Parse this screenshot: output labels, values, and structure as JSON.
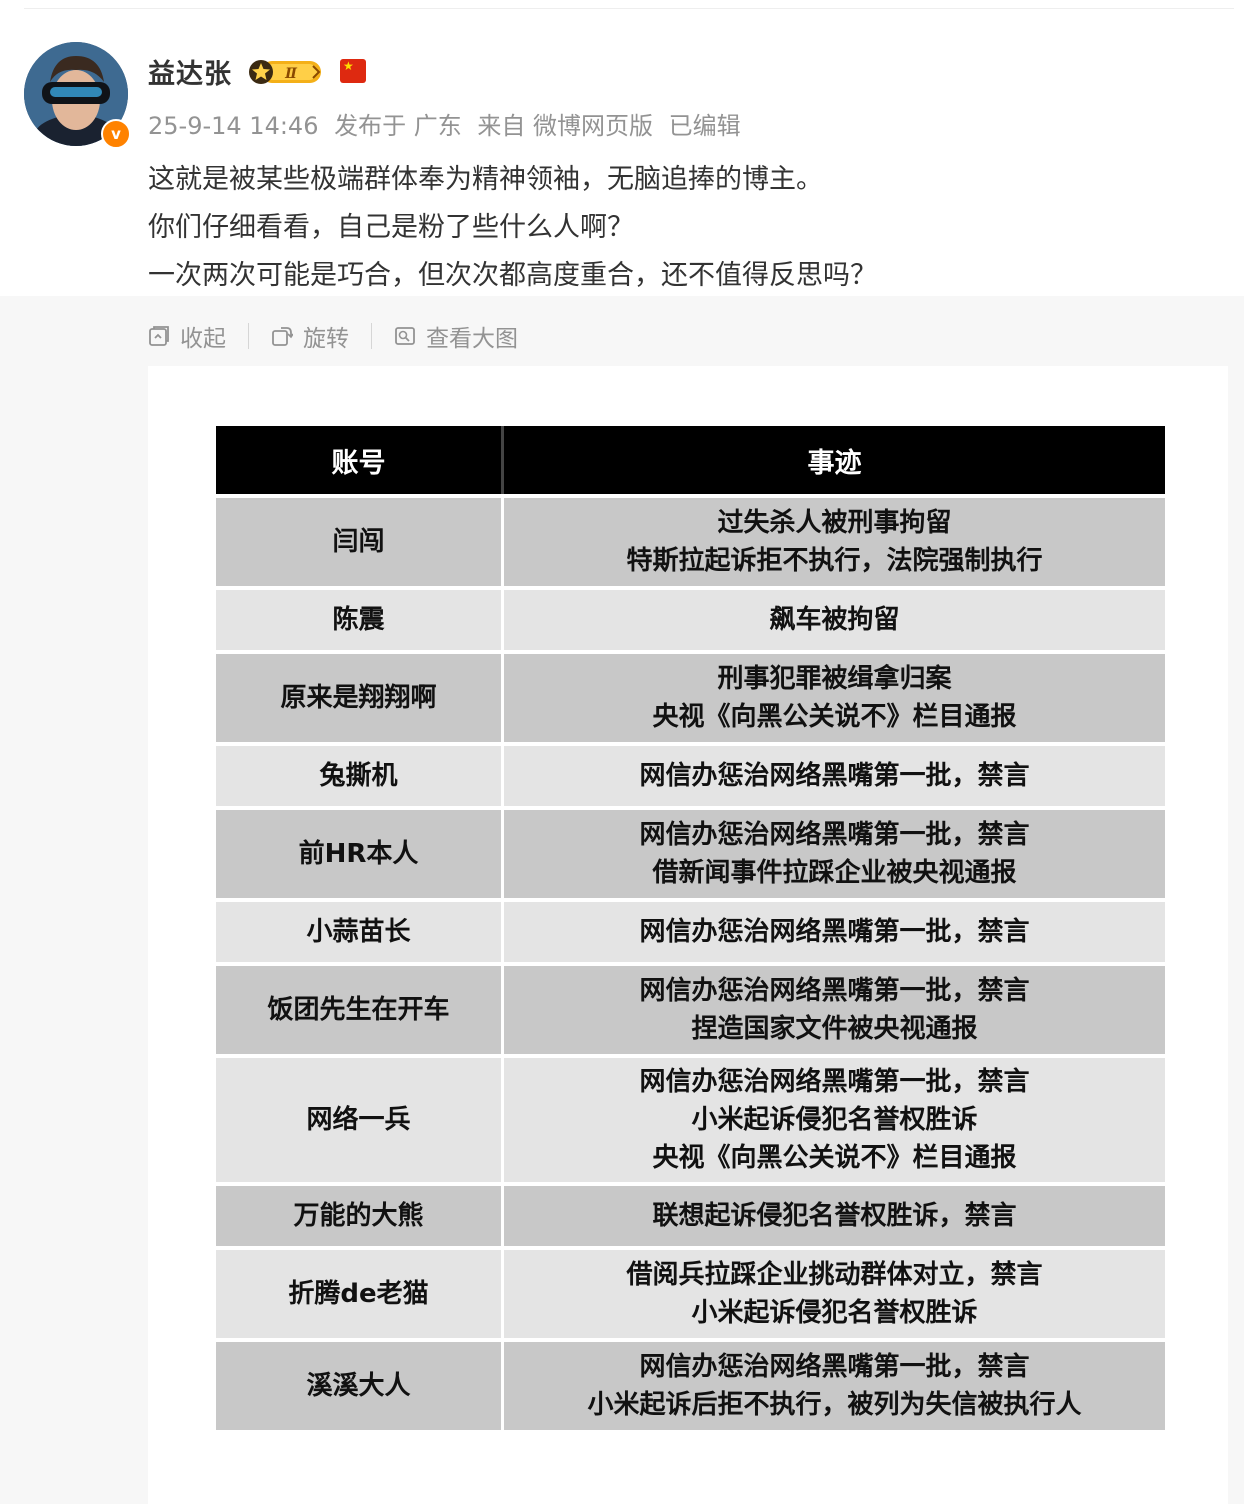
{
  "author": {
    "name": "益达张",
    "vip_level": "Ⅱ",
    "verified": true,
    "flag": "flag-icon"
  },
  "meta": {
    "date": "25-9-14 14:46",
    "location": "发布于 广东",
    "source": "来自 微博网页版",
    "edited": "已编辑"
  },
  "post": {
    "lines": [
      "这就是被某些极端群体奉为精神领袖，无脑追捧的博主。",
      "你们仔细看看，自己是粉了些什么人啊？",
      "一次两次可能是巧合，但次次都高度重合，还不值得反思吗？"
    ]
  },
  "toolbar": {
    "collapse": "收起",
    "rotate": "旋转",
    "view_large": "查看大图"
  },
  "table": {
    "headers": [
      "账号",
      "事迹"
    ],
    "rows": [
      {
        "account": "闫闯",
        "deeds": [
          "过失杀人被刑事拘留",
          "特斯拉起诉拒不执行，法院强制执行"
        ],
        "shade": "dark"
      },
      {
        "account": "陈震",
        "deeds": [
          "飙车被拘留"
        ],
        "shade": "light"
      },
      {
        "account": "原来是翔翔啊",
        "deeds": [
          "刑事犯罪被缉拿归案",
          "央视《向黑公关说不》栏目通报"
        ],
        "shade": "dark"
      },
      {
        "account": "兔撕机",
        "deeds": [
          "网信办惩治网络黑嘴第一批，禁言"
        ],
        "shade": "light"
      },
      {
        "account": "前HR本人",
        "deeds": [
          "网信办惩治网络黑嘴第一批，禁言",
          "借新闻事件拉踩企业被央视通报"
        ],
        "shade": "dark"
      },
      {
        "account": "小蒜苗长",
        "deeds": [
          "网信办惩治网络黑嘴第一批，禁言"
        ],
        "shade": "light"
      },
      {
        "account": "饭团先生在开车",
        "deeds": [
          "网信办惩治网络黑嘴第一批，禁言",
          "捏造国家文件被央视通报"
        ],
        "shade": "dark"
      },
      {
        "account": "网络一兵",
        "deeds": [
          "网信办惩治网络黑嘴第一批，禁言",
          "小米起诉侵犯名誉权胜诉",
          "央视《向黑公关说不》栏目通报"
        ],
        "shade": "light"
      },
      {
        "account": "万能的大熊",
        "deeds": [
          "联想起诉侵犯名誉权胜诉，禁言"
        ],
        "shade": "dark"
      },
      {
        "account": "折腾de老猫",
        "deeds": [
          "借阅兵拉踩企业挑动群体对立，禁言",
          "小米起诉侵犯名誉权胜诉"
        ],
        "shade": "light"
      },
      {
        "account": "溪溪大人",
        "deeds": [
          "网信办惩治网络黑嘴第一批，禁言",
          "小米起诉后拒不执行，被列为失信被执行人"
        ],
        "shade": "dark"
      }
    ]
  },
  "colors": {
    "accent": "#ff8200",
    "meta_text": "#939393",
    "header_bg": "#000000",
    "row_dark": "#c8c8c8",
    "row_light": "#e4e4e4"
  }
}
